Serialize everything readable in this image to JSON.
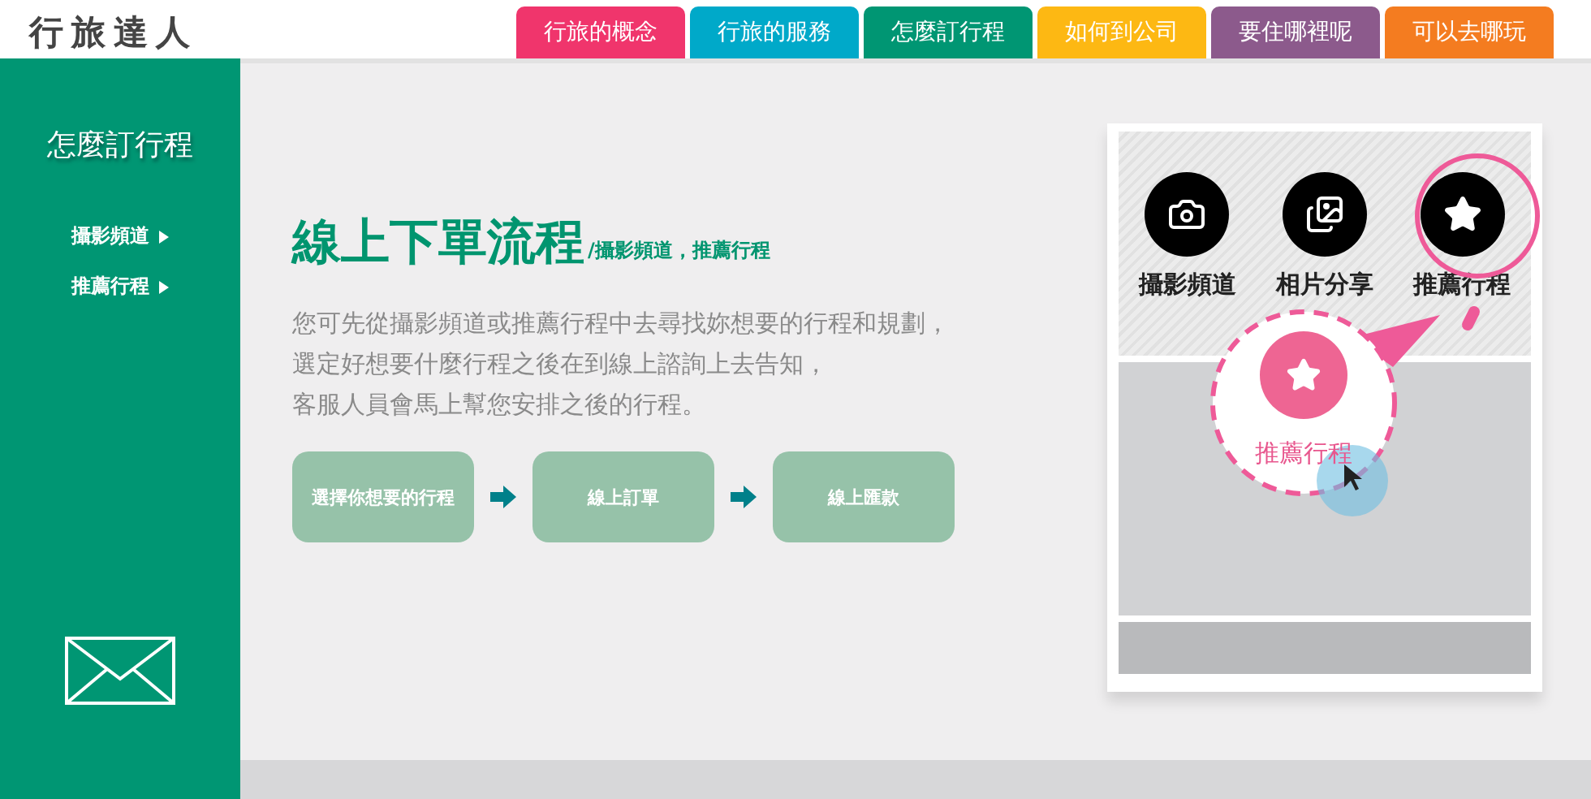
{
  "header": {
    "logo": "行旅達人"
  },
  "nav": [
    {
      "label": "行旅的概念",
      "color": "#f0356c"
    },
    {
      "label": "行旅的服務",
      "color": "#00a9c9"
    },
    {
      "label": "怎麼訂行程",
      "color": "#009673"
    },
    {
      "label": "如何到公司",
      "color": "#fdb813"
    },
    {
      "label": "要住哪裡呢",
      "color": "#8c5a8c"
    },
    {
      "label": "可以去哪玩",
      "color": "#f47c20"
    }
  ],
  "sidebar": {
    "title": "怎麼訂行程",
    "items": [
      {
        "label": "攝影頻道"
      },
      {
        "label": "推薦行程"
      }
    ]
  },
  "main": {
    "title": "線上下單流程",
    "subtitle": "/攝影頻道，推薦行程",
    "paragraph": [
      "您可先從攝影頻道或推薦行程中去尋找妳想要的行程和規劃，",
      "選定好想要什麼行程之後在到線上諮詢上去告知，",
      "客服人員會馬上幫您安排之後的行程。"
    ],
    "steps": [
      "選擇你想要的行程",
      "線上訂單",
      "線上匯款"
    ]
  },
  "illustration": {
    "apps": [
      {
        "label": "攝影頻道",
        "kind": "camera"
      },
      {
        "label": "相片分享",
        "kind": "photos"
      },
      {
        "label": "推薦行程",
        "kind": "star"
      }
    ],
    "zoom_label": "推薦行程"
  }
}
